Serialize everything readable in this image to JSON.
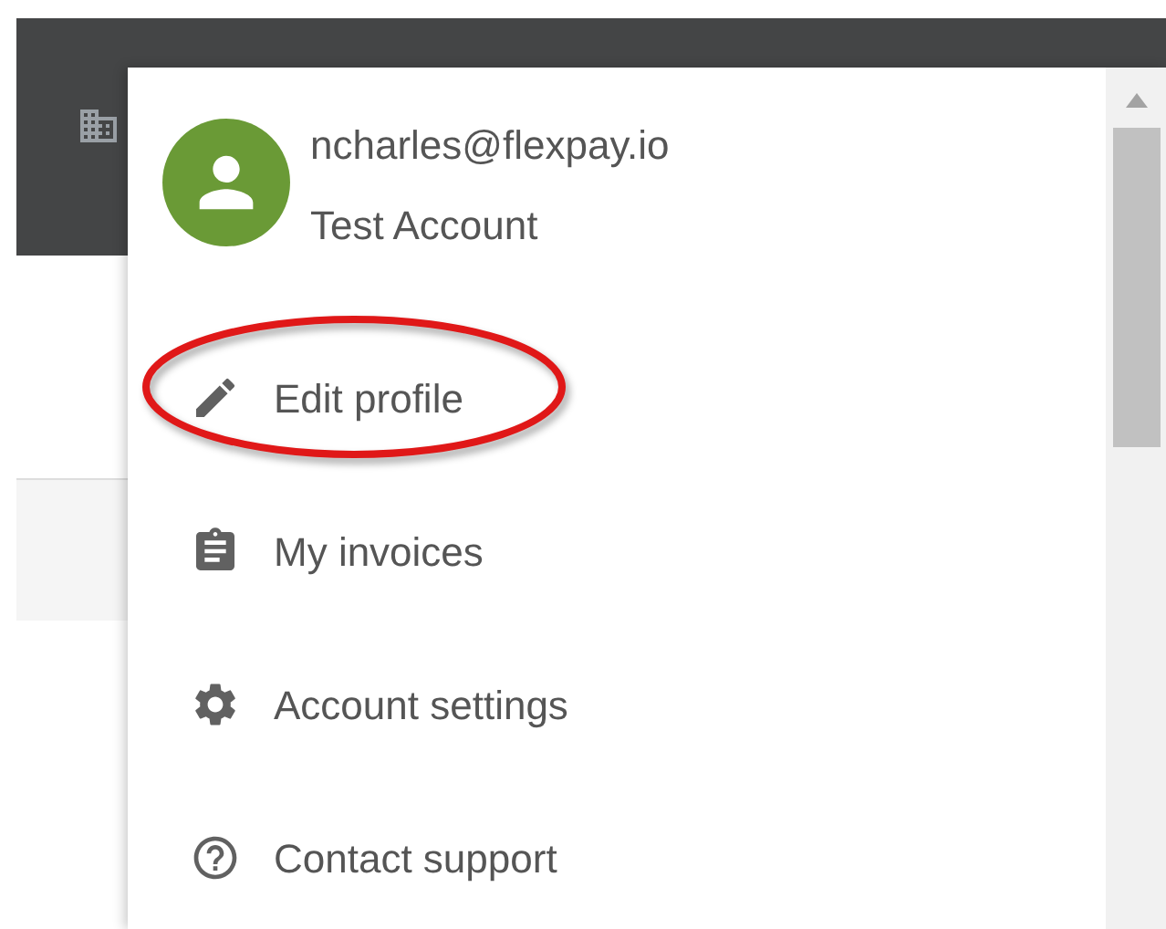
{
  "account_menu": {
    "email": "ncharles@flexpay.io",
    "account_name": "Test Account",
    "items": [
      {
        "kind": "edit",
        "label": "Edit profile",
        "highlighted": true
      },
      {
        "kind": "invoices",
        "label": "My invoices",
        "highlighted": false
      },
      {
        "kind": "settings",
        "label": "Account settings",
        "highlighted": false
      },
      {
        "kind": "support",
        "label": "Contact support",
        "highlighted": false
      }
    ]
  }
}
